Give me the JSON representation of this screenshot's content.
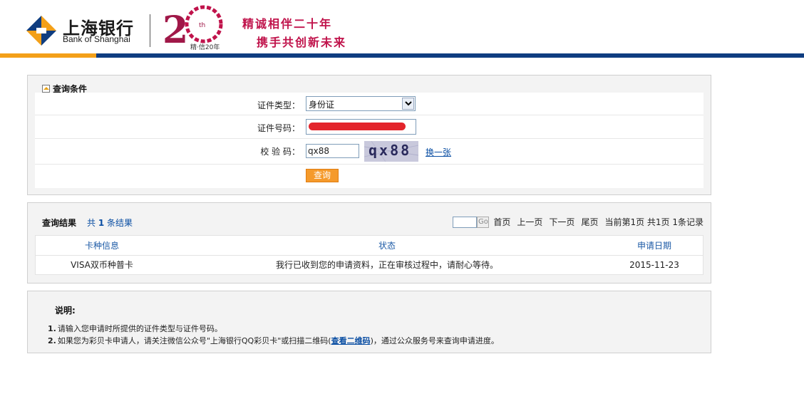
{
  "header": {
    "brand_cn": "上海银行",
    "brand_en": "Bank of Shanghai",
    "anniv_sup": "th",
    "anniv_sub": "精·信20年",
    "slogan_line1": "精诚相伴二十年",
    "slogan_line2": "携手共创新未来",
    "colors": {
      "brand_blue": "#0f3d80",
      "brand_gold": "#f3a019",
      "slogan": "#c0134b"
    }
  },
  "query": {
    "title": "查询条件",
    "id_type_label": "证件类型：",
    "id_type_value": "身份证",
    "id_number_label": "证件号码：",
    "captcha_label": "校 验 码：",
    "captcha_value": "qx88",
    "captcha_image_text": "qx88",
    "refresh_link": "换一张",
    "submit_label": "查询"
  },
  "results": {
    "title": "查询结果",
    "count_prefix": "共",
    "count": "1",
    "count_suffix": "条结果",
    "pager": {
      "go_label": "Go",
      "first": "首页",
      "prev": "上一页",
      "next": "下一页",
      "last": "尾页",
      "status": "当前第1页 共1页 1条记录"
    },
    "columns": [
      "卡种信息",
      "状态",
      "申请日期"
    ],
    "rows": [
      {
        "card": "VISA双币种普卡",
        "status": "我行已收到您的申请资料，正在审核过程中，请耐心等待。",
        "date": "2015-11-23"
      }
    ]
  },
  "notes": {
    "title": "说明:",
    "line1_num": "1.",
    "line1": "请输入您申请时所提供的证件类型与证件号码。",
    "line2_num": "2.",
    "line2_before": "如果您为彩贝卡申请人，请关注微信公众号\"上海银行QQ彩贝卡\"或扫描二维码(",
    "line2_link": "查看二维码",
    "line2_after": ")，通过公众服务号来查询申请进度。"
  }
}
